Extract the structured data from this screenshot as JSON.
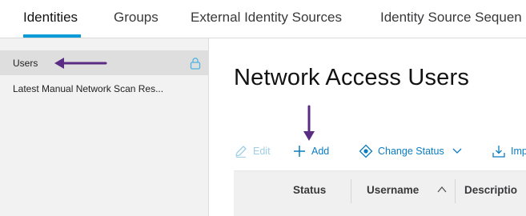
{
  "tabs": [
    {
      "label": "Identities",
      "active": true
    },
    {
      "label": "Groups",
      "active": false
    },
    {
      "label": "External Identity Sources",
      "active": false
    },
    {
      "label": "Identity Source Sequen",
      "active": false
    }
  ],
  "sidebar": {
    "items": [
      {
        "label": "Users",
        "icon": "lock-icon",
        "active": true
      },
      {
        "label": "Latest Manual Network Scan Res...",
        "active": false
      }
    ]
  },
  "main": {
    "title": "Network Access Users",
    "toolbar": {
      "edit_label": "Edit",
      "add_label": "Add",
      "change_status_label": "Change Status",
      "import_label": "Imp"
    },
    "table": {
      "columns": [
        "Status",
        "Username",
        "Descriptio"
      ]
    }
  },
  "colors": {
    "accent": "#0d9bd8",
    "link": "#0a7cc0",
    "disabled": "#9fcfe8",
    "annotation_arrow": "#5b2c83"
  }
}
